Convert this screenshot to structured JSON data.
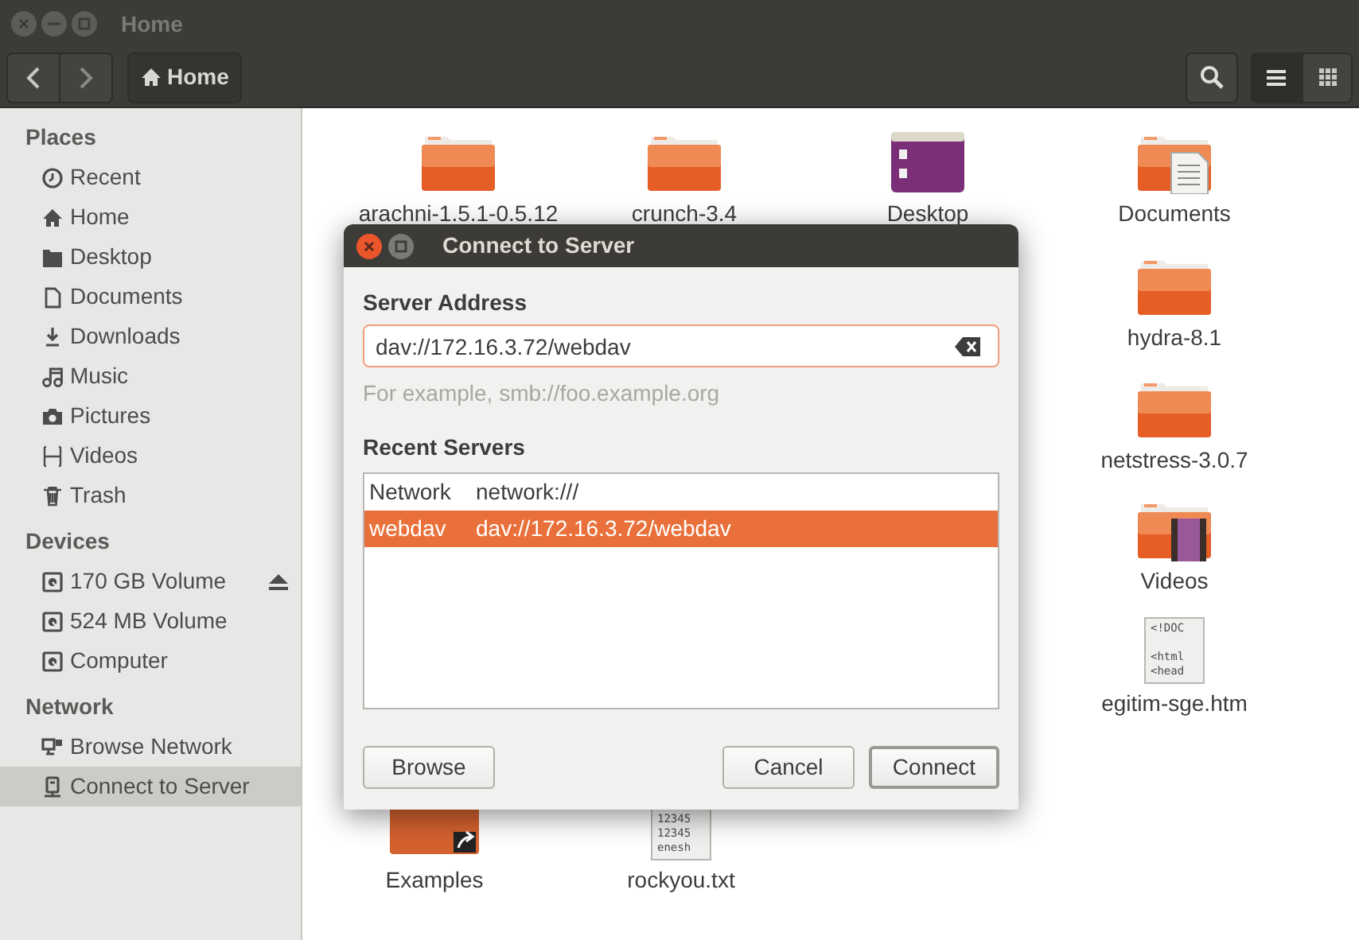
{
  "window": {
    "title": "Home"
  },
  "toolbar": {
    "location": "Home",
    "view_buttons": [
      {
        "kind": "list",
        "selected": true
      },
      {
        "kind": "grid",
        "selected": false
      }
    ]
  },
  "sidebar": {
    "sections": [
      {
        "title": "Places",
        "items": [
          {
            "label": "Recent",
            "selected": false
          },
          {
            "label": "Home",
            "selected": false
          },
          {
            "label": "Desktop",
            "selected": false
          },
          {
            "label": "Documents",
            "selected": false
          },
          {
            "label": "Downloads",
            "selected": false
          },
          {
            "label": "Music",
            "selected": false
          },
          {
            "label": "Pictures",
            "selected": false
          },
          {
            "label": "Videos",
            "selected": false
          },
          {
            "label": "Trash",
            "selected": false
          }
        ]
      },
      {
        "title": "Devices",
        "items": [
          {
            "label": "170 GB Volume",
            "selected": false,
            "eject": true
          },
          {
            "label": "524 MB Volume",
            "selected": false,
            "eject": false
          },
          {
            "label": "Computer",
            "selected": false,
            "eject": false
          }
        ]
      },
      {
        "title": "Network",
        "items": [
          {
            "label": "Browse Network",
            "selected": false
          },
          {
            "label": "Connect to Server",
            "selected": true
          }
        ]
      }
    ]
  },
  "files": [
    {
      "name": "arachni-1.5.1-0.5.12",
      "kind": "folder"
    },
    {
      "name": "crunch-3.4",
      "kind": "folder"
    },
    {
      "name": "Desktop",
      "kind": "desktop"
    },
    {
      "name": "Documents",
      "kind": "documents"
    },
    {
      "name": "hydra-8.1",
      "kind": "folder"
    },
    {
      "name": "netstress-3.0.7",
      "kind": "folder"
    },
    {
      "name": "Videos",
      "kind": "videos"
    },
    {
      "name": "egitim-sge.htm",
      "kind": "text",
      "preview": [
        "<!DOC",
        "<html",
        "<head"
      ]
    },
    {
      "name": "Examples",
      "kind": "link"
    },
    {
      "name": "rockyou.txt",
      "kind": "text",
      "preview": [
        "12345",
        "12345",
        "enesh"
      ]
    }
  ],
  "dialog": {
    "title": "Connect to Server",
    "address_label": "Server Address",
    "address": "dav://172.16.3.72/webdav",
    "hint": "For example, smb://foo.example.org",
    "recent_label": "Recent Servers",
    "recent": [
      {
        "name": "Network",
        "uri": "network:///",
        "selected": false
      },
      {
        "name": "webdav",
        "uri": "dav://172.16.3.72/webdav",
        "selected": true
      }
    ],
    "buttons": [
      {
        "label": "Browse",
        "default": false
      },
      {
        "label": "Cancel",
        "default": false
      },
      {
        "label": "Connect",
        "default": true
      }
    ]
  }
}
